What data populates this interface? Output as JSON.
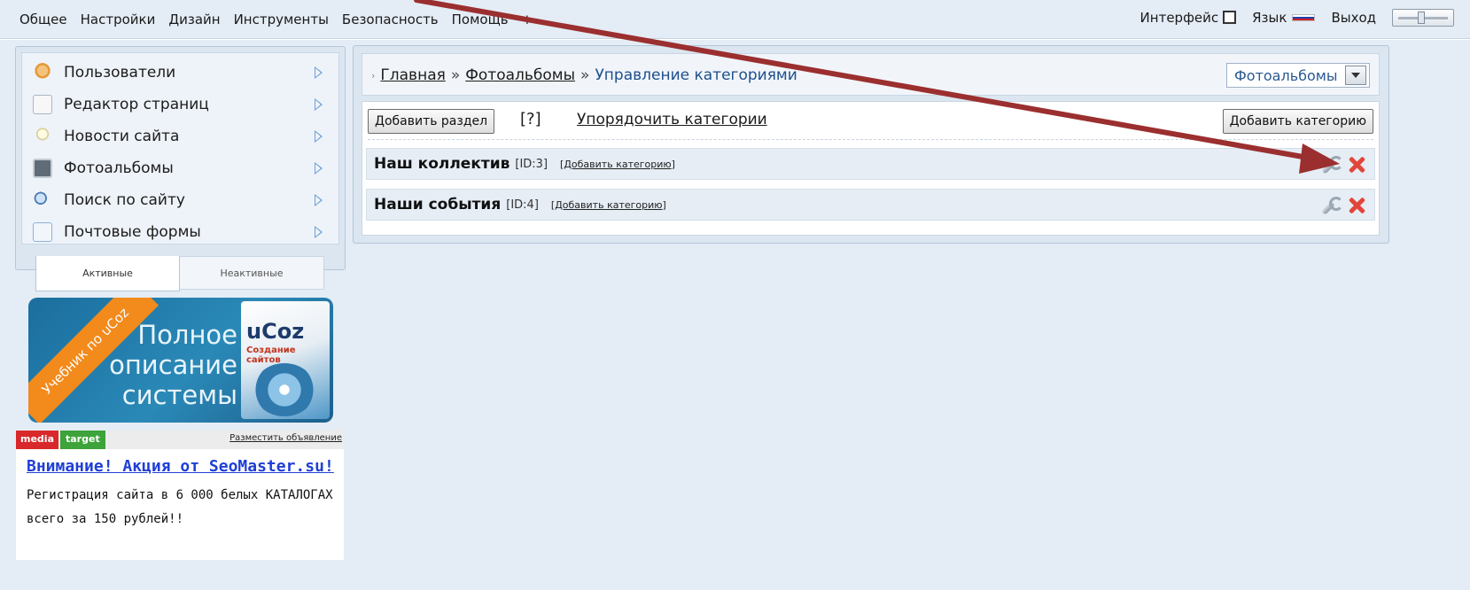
{
  "topmenu": {
    "items": [
      "Общее",
      "Настройки",
      "Дизайн",
      "Инструменты",
      "Безопасность",
      "Помощь"
    ],
    "plus": "+",
    "interface_label": "Интерфейс",
    "language_label": "Язык",
    "logout_label": "Выход"
  },
  "sidebar": {
    "items": [
      {
        "label": "Пользователи",
        "icon": "users-icon"
      },
      {
        "label": "Редактор страниц",
        "icon": "page-editor-icon"
      },
      {
        "label": "Новости сайта",
        "icon": "lightbulb-icon"
      },
      {
        "label": "Фотоальбомы",
        "icon": "camera-icon"
      },
      {
        "label": "Поиск по сайту",
        "icon": "search-icon"
      },
      {
        "label": "Почтовые формы",
        "icon": "mail-icon"
      }
    ],
    "tabs": {
      "active": "Активные",
      "inactive": "Неактивные"
    }
  },
  "banner": {
    "ribbon": "Учебник по uCoz",
    "line1": "Полное",
    "line2": "описание",
    "line3": "системы",
    "logo": "uCoz",
    "logo_sub": "Создание сайтов"
  },
  "ad": {
    "media": "media",
    "target": "target",
    "place_link": "Разместить объявление",
    "title": "Внимание! Акция от SeoMaster.su!",
    "body": "Регистрация сайта в 6 000 белых КАТАЛОГАХ всего за 150 рублей!!"
  },
  "breadcrumb": {
    "home": "Главная",
    "sep": "»",
    "albums": "Фотоальбомы",
    "current": "Управление категориями"
  },
  "module_select": {
    "value": "Фотоальбомы"
  },
  "toolbar": {
    "add_section": "Добавить раздел",
    "help": "[?]",
    "reorder": "Упорядочить категории",
    "add_category": "Добавить категорию"
  },
  "sections": [
    {
      "name": "Наш коллектив",
      "id": "[ID:3]",
      "add": "Добавить категорию"
    },
    {
      "name": "Наши события",
      "id": "[ID:4]",
      "add": "Добавить категорию"
    }
  ],
  "colors": {
    "annotation_arrow": "#9b2f2f",
    "link_blue": "#1f3fd6"
  }
}
